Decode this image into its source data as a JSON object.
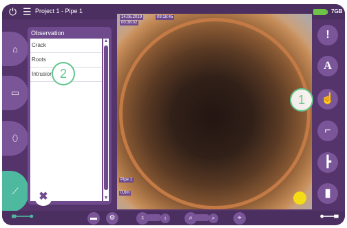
{
  "header": {
    "title": "Project 1 - Pipe 1",
    "storage": "7GB",
    "icons": {
      "power": "power-icon",
      "menu": "hamburger-menu-icon",
      "battery": "battery-icon"
    }
  },
  "left_nav": [
    {
      "name": "home-icon"
    },
    {
      "name": "folder-icon"
    },
    {
      "name": "camera-probe-icon"
    },
    {
      "name": "crawler-icon"
    }
  ],
  "observation_panel": {
    "title": "Observation",
    "items": [
      "Crack",
      "Roots",
      "Intrusion"
    ]
  },
  "video": {
    "date": "14.06.2019",
    "time": "09:18:45",
    "duration": "00:38:02",
    "pipe_label": "Pipe 1",
    "distance": "0,6m"
  },
  "right_tools": [
    {
      "icon": "exclamation-icon",
      "label": "!"
    },
    {
      "icon": "text-annotation-icon",
      "label": "A"
    },
    {
      "icon": "hand-point-icon",
      "label": "☝"
    },
    {
      "icon": "pipe-bend-icon",
      "label": "⌐"
    },
    {
      "icon": "pipe-branch-icon",
      "label": "┣"
    },
    {
      "icon": "pipe-straight-icon",
      "label": "▮"
    }
  ],
  "callouts": {
    "one": "1",
    "two": "2"
  },
  "bottom_bar": {
    "icons": [
      "ruler-icon",
      "settings-icon",
      "light-icon",
      "zoom-icon",
      "location-pin-icon",
      "left-connector-icon",
      "right-connector-icon"
    ]
  },
  "colors": {
    "brand": "#54346b",
    "accent_green": "#4fb9a0",
    "battery": "#6ec247",
    "indicator": "#f4dc16"
  }
}
